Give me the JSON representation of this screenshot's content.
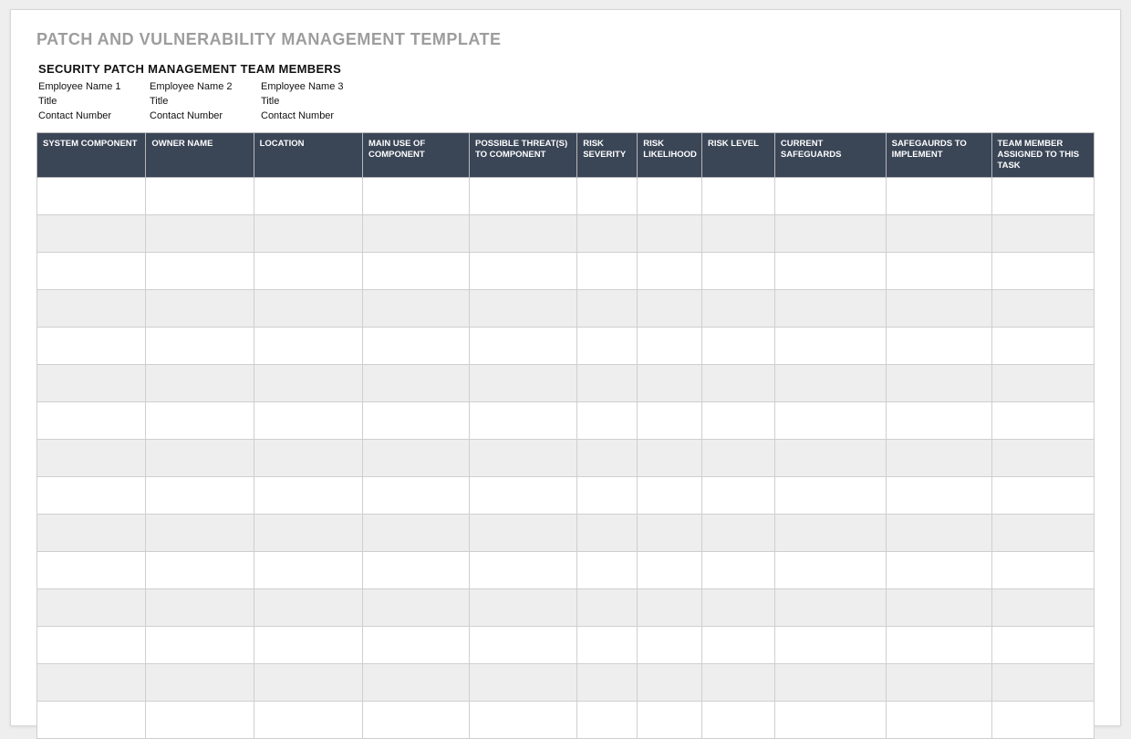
{
  "title": "PATCH AND VULNERABILITY MANAGEMENT TEMPLATE",
  "section_title": "SECURITY PATCH MANAGEMENT TEAM MEMBERS",
  "team_members": [
    {
      "name": "Employee Name 1",
      "title": "Title",
      "contact": "Contact Number"
    },
    {
      "name": "Employee Name 2",
      "title": "Title",
      "contact": "Contact Number"
    },
    {
      "name": "Employee Name 3",
      "title": "Title",
      "contact": "Contact Number"
    }
  ],
  "columns": [
    "SYSTEM COMPONENT",
    "OWNER NAME",
    "LOCATION",
    "MAIN USE OF COMPONENT",
    "POSSIBLE THREAT(S) TO COMPONENT",
    "RISK SEVERITY",
    "RISK LIKELIHOOD",
    "RISK LEVEL",
    "CURRENT SAFEGUARDS",
    "SAFEGAURDS TO IMPLEMENT",
    "TEAM MEMBER ASSIGNED TO THIS TASK"
  ],
  "row_count": 15
}
